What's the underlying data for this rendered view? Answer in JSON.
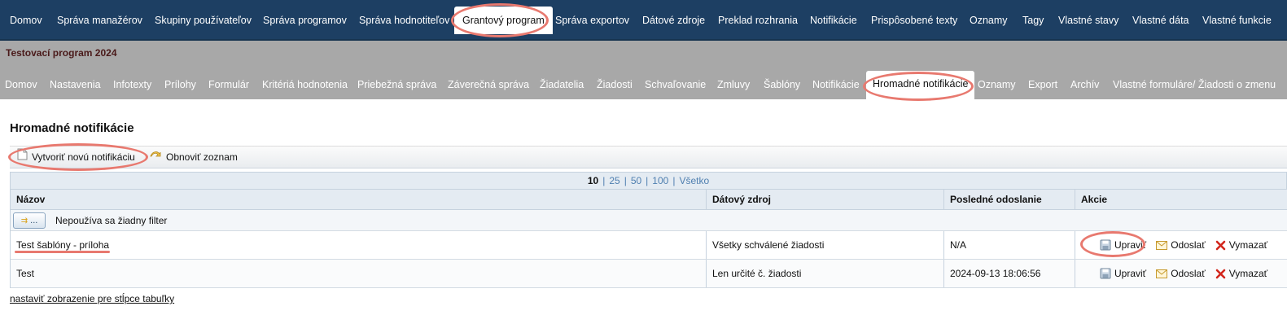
{
  "topnav": {
    "items": [
      "Domov",
      "Správa manažérov",
      "Skupiny používateľov",
      "Správa programov",
      "Správa hodnotiteľov",
      "Grantový program",
      "Správa exportov",
      "Dátové zdroje",
      "Preklad rozhrania",
      "Notifikácie",
      "Prispôsobené texty",
      "Oznamy",
      "Tagy",
      "Vlastné stavy",
      "Vlastné dáta",
      "Vlastné funkcie"
    ],
    "active": "Grantový program"
  },
  "program": {
    "title": "Testovací program 2024",
    "tabs": [
      "Domov",
      "Nastavenia",
      "Infotexty",
      "Prílohy",
      "Formulár",
      "Kritériá hodnotenia",
      "Priebežná správa",
      "Záverečná správa",
      "Žiadatelia",
      "Žiadosti",
      "Schvaľovanie",
      "Zmluvy",
      "Šablóny",
      "Notifikácie",
      "Hromadné notifikácie",
      "Oznamy",
      "Export",
      "Archív",
      "Vlastné formuláre/ Žiadosti o zmenu"
    ],
    "active": "Hromadné notifikácie"
  },
  "page": {
    "title": "Hromadné notifikácie"
  },
  "toolbar": {
    "create_label": "Vytvoriť novú notifikáciu",
    "refresh_label": "Obnoviť zoznam"
  },
  "pager": {
    "current": "10",
    "options": [
      "25",
      "50",
      "100",
      "Všetko"
    ]
  },
  "table": {
    "columns": [
      "Názov",
      "Dátový zdroj",
      "Posledné odoslanie",
      "Akcie"
    ],
    "filter_button": "...",
    "filter_text": "Nepoužíva sa žiadny filter",
    "rows": [
      {
        "name": "Test šablóny - príloha",
        "source": "Všetky schválené žiadosti",
        "last_sent": "N/A"
      },
      {
        "name": "Test",
        "source": "Len určité č. žiadosti",
        "last_sent": "2024-09-13 18:06:56"
      }
    ],
    "actions": {
      "edit": "Upraviť",
      "send": "Odoslať",
      "delete": "Vymazať"
    }
  },
  "footer": {
    "link": "nastaviť zobrazenie pre stĺpce tabuľky"
  },
  "colors": {
    "nav_bg": "#1d3f63",
    "subnav_bg": "#a8a8a8",
    "highlight": "#e8796f",
    "link": "#4f7fb0"
  }
}
